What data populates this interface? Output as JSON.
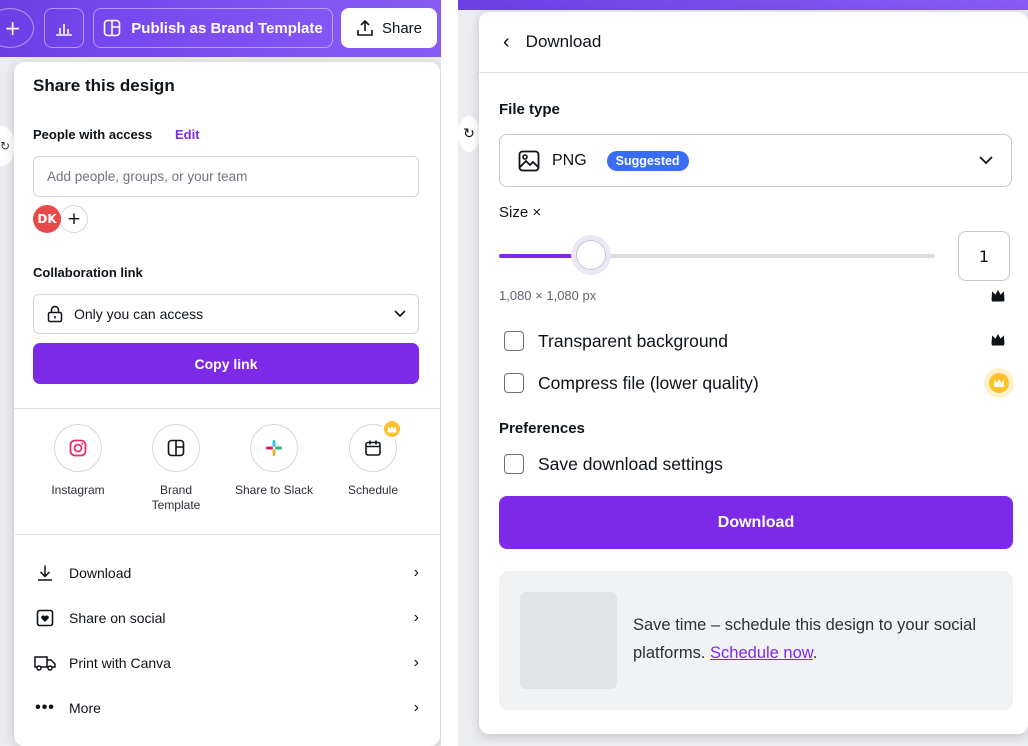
{
  "topbar": {
    "publish_label": "Publish as Brand Template",
    "share_label": "Share"
  },
  "share_panel": {
    "title": "Share this design",
    "people_access_label": "People with access",
    "edit_label": "Edit",
    "people_input_placeholder": "Add people, groups, or your team",
    "avatar_initials": "DK",
    "collab_link_label": "Collaboration link",
    "access_select_value": "Only you can access",
    "copy_link_label": "Copy link",
    "share_options": [
      {
        "label": "Instagram",
        "icon": "instagram-icon"
      },
      {
        "label": "Brand Template",
        "icon": "brand-template-icon"
      },
      {
        "label": "Share to Slack",
        "icon": "slack-icon"
      },
      {
        "label": "Schedule",
        "icon": "calendar-icon"
      }
    ],
    "menu_items": [
      {
        "label": "Download",
        "icon": "download-icon"
      },
      {
        "label": "Share on social",
        "icon": "heart-box-icon"
      },
      {
        "label": "Print with Canva",
        "icon": "truck-icon"
      },
      {
        "label": "More",
        "icon": "more-dots-icon"
      }
    ]
  },
  "download_panel": {
    "title": "Download",
    "file_type_label": "File type",
    "file_type_value": "PNG",
    "suggested_badge": "Suggested",
    "size_label": "Size ×",
    "size_value": "1",
    "size_slider_fraction": 0.21,
    "dimensions": "1,080 × 1,080 px",
    "transparent_bg_label": "Transparent background",
    "compress_label": "Compress file (lower quality)",
    "preferences_label": "Preferences",
    "save_settings_label": "Save download settings",
    "download_button": "Download",
    "promo_text": "Save time – schedule this design to your social platforms.",
    "promo_link": "Schedule now",
    "promo_suffix": "."
  },
  "colors": {
    "brand_purple": "#7d2ae8",
    "topbar_purple": "#6c3fe6",
    "suggested_blue": "#3b6cf7",
    "premium_yellow": "#ffc22c",
    "avatar_red": "#e84a4a"
  }
}
